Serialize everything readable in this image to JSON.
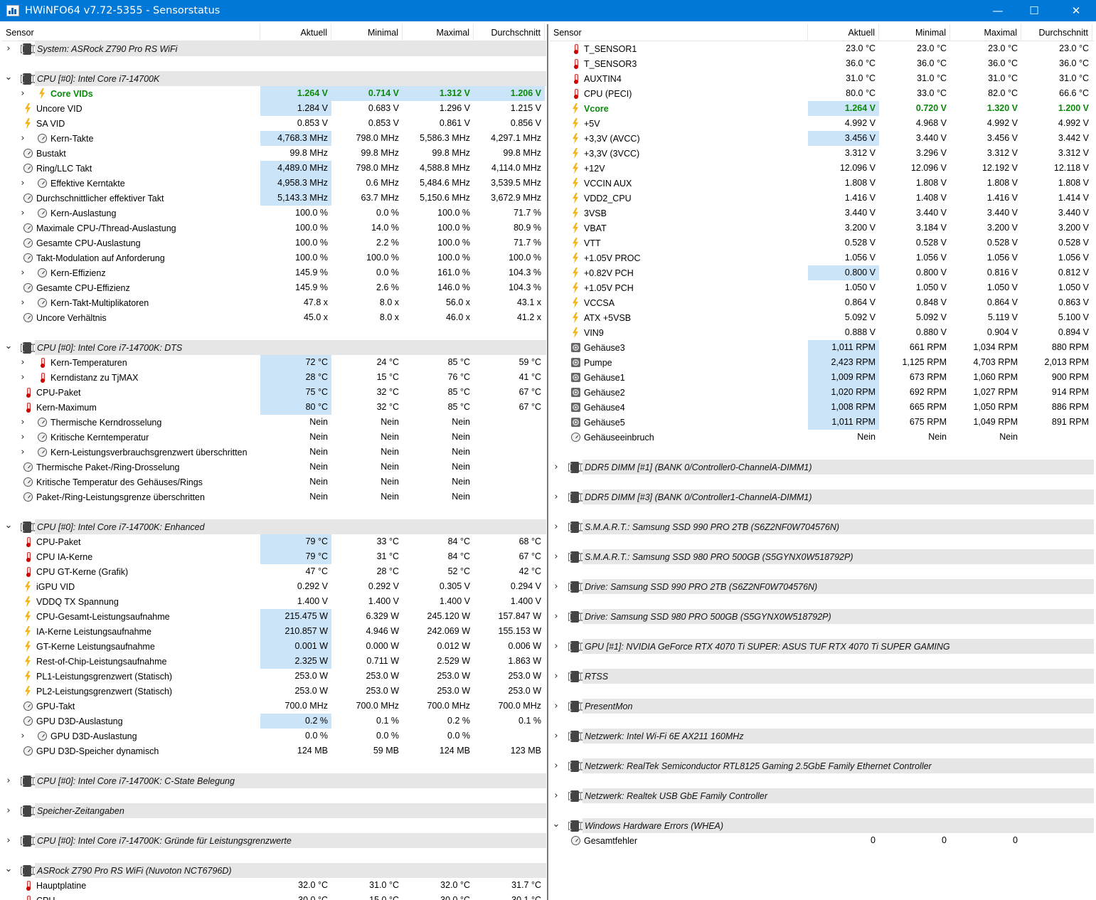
{
  "window": {
    "title": "HWiNFO64 v7.72-5355 - Sensorstatus",
    "minimize_icon": "minimize-icon",
    "maximize_icon": "maximize-icon",
    "close_icon": "close-icon",
    "app_icon": "hwinfo-app-icon"
  },
  "colors": {
    "titlebar": "#0078d7",
    "group_bar": "#e6e6e6",
    "highlight": "#cce4f7",
    "bold_green": "#0a8a0a"
  },
  "columns": [
    "Sensor",
    "Aktuell",
    "Minimal",
    "Maximal",
    "Durchschnitt"
  ],
  "left": [
    {
      "t": "g",
      "e": "c",
      "l": "System: ASRock Z790 Pro RS WiFi"
    },
    {
      "t": "b"
    },
    {
      "t": "g",
      "e": "o",
      "l": "CPU [#0]: Intel Core i7-14700K"
    },
    {
      "i": "bolt",
      "e": "c",
      "in": 1,
      "b": 1,
      "h": [
        1,
        1,
        1,
        1
      ],
      "l": "Core VIDs",
      "v": [
        "1.264 V",
        "0.714 V",
        "1.312 V",
        "1.206 V"
      ]
    },
    {
      "i": "bolt",
      "l": "Uncore VID",
      "h": [
        1,
        0,
        0,
        0
      ],
      "v": [
        "1.284 V",
        "0.683 V",
        "1.296 V",
        "1.215 V"
      ]
    },
    {
      "i": "bolt",
      "l": "SA VID",
      "v": [
        "0.853 V",
        "0.853 V",
        "0.861 V",
        "0.856 V"
      ]
    },
    {
      "i": "clock",
      "e": "c",
      "in": 1,
      "h": [
        1,
        0,
        0,
        0
      ],
      "l": "Kern-Takte",
      "v": [
        "4,768.3 MHz",
        "798.0 MHz",
        "5,586.3 MHz",
        "4,297.1 MHz"
      ]
    },
    {
      "i": "clock",
      "l": "Bustakt",
      "v": [
        "99.8 MHz",
        "99.8 MHz",
        "99.8 MHz",
        "99.8 MHz"
      ]
    },
    {
      "i": "clock",
      "l": "Ring/LLC Takt",
      "h": [
        1,
        0,
        0,
        0
      ],
      "v": [
        "4,489.0 MHz",
        "798.0 MHz",
        "4,588.8 MHz",
        "4,114.0 MHz"
      ]
    },
    {
      "i": "clock",
      "e": "c",
      "in": 1,
      "h": [
        1,
        0,
        0,
        0
      ],
      "l": "Effektive Kerntakte",
      "v": [
        "4,958.3 MHz",
        "0.6 MHz",
        "5,484.6 MHz",
        "3,539.5 MHz"
      ]
    },
    {
      "i": "clock",
      "l": "Durchschnittlicher effektiver Takt",
      "h": [
        1,
        0,
        0,
        0
      ],
      "v": [
        "5,143.3 MHz",
        "63.7 MHz",
        "5,150.6 MHz",
        "3,672.9 MHz"
      ]
    },
    {
      "i": "clock",
      "e": "c",
      "in": 1,
      "l": "Kern-Auslastung",
      "v": [
        "100.0 %",
        "0.0 %",
        "100.0 %",
        "71.7 %"
      ]
    },
    {
      "i": "clock",
      "l": "Maximale CPU-/Thread-Auslastung",
      "v": [
        "100.0 %",
        "14.0 %",
        "100.0 %",
        "80.9 %"
      ]
    },
    {
      "i": "clock",
      "l": "Gesamte CPU-Auslastung",
      "v": [
        "100.0 %",
        "2.2 %",
        "100.0 %",
        "71.7 %"
      ]
    },
    {
      "i": "clock",
      "l": "Takt-Modulation auf Anforderung",
      "v": [
        "100.0 %",
        "100.0 %",
        "100.0 %",
        "100.0 %"
      ]
    },
    {
      "i": "clock",
      "e": "c",
      "in": 1,
      "l": "Kern-Effizienz",
      "v": [
        "145.9 %",
        "0.0 %",
        "161.0 %",
        "104.3 %"
      ]
    },
    {
      "i": "clock",
      "l": "Gesamte CPU-Effizienz",
      "v": [
        "145.9 %",
        "2.6 %",
        "146.0 %",
        "104.3 %"
      ]
    },
    {
      "i": "clock",
      "e": "c",
      "in": 1,
      "l": "Kern-Takt-Multiplikatoren",
      "v": [
        "47.8 x",
        "8.0 x",
        "56.0 x",
        "43.1 x"
      ]
    },
    {
      "i": "clock",
      "l": "Uncore Verhältnis",
      "v": [
        "45.0 x",
        "8.0 x",
        "46.0 x",
        "41.2 x"
      ]
    },
    {
      "t": "b"
    },
    {
      "t": "g",
      "e": "o",
      "l": "CPU [#0]: Intel Core i7-14700K: DTS"
    },
    {
      "i": "therm",
      "e": "c",
      "in": 1,
      "h": [
        1,
        0,
        0,
        0
      ],
      "l": "Kern-Temperaturen",
      "v": [
        "72 °C",
        "24 °C",
        "85 °C",
        "59 °C"
      ]
    },
    {
      "i": "therm",
      "e": "c",
      "in": 1,
      "h": [
        1,
        0,
        0,
        0
      ],
      "l": "Kerndistanz zu TjMAX",
      "v": [
        "28 °C",
        "15 °C",
        "76 °C",
        "41 °C"
      ]
    },
    {
      "i": "therm",
      "l": "CPU-Paket",
      "h": [
        1,
        0,
        0,
        0
      ],
      "v": [
        "75 °C",
        "32 °C",
        "85 °C",
        "67 °C"
      ]
    },
    {
      "i": "therm",
      "l": "Kern-Maximum",
      "h": [
        1,
        0,
        0,
        0
      ],
      "v": [
        "80 °C",
        "32 °C",
        "85 °C",
        "67 °C"
      ]
    },
    {
      "i": "clock",
      "e": "c",
      "in": 1,
      "l": "Thermische Kerndrosselung",
      "v": [
        "Nein",
        "Nein",
        "Nein",
        ""
      ]
    },
    {
      "i": "clock",
      "e": "c",
      "in": 1,
      "l": "Kritische Kerntemperatur",
      "v": [
        "Nein",
        "Nein",
        "Nein",
        ""
      ]
    },
    {
      "i": "clock",
      "e": "c",
      "in": 1,
      "l": "Kern-Leistungsverbrauchsgrenzwert überschritten",
      "v": [
        "Nein",
        "Nein",
        "Nein",
        ""
      ]
    },
    {
      "i": "clock",
      "l": "Thermische Paket-/Ring-Drosselung",
      "v": [
        "Nein",
        "Nein",
        "Nein",
        ""
      ]
    },
    {
      "i": "clock",
      "l": "Kritische Temperatur des Gehäuses/Rings",
      "v": [
        "Nein",
        "Nein",
        "Nein",
        ""
      ]
    },
    {
      "i": "clock",
      "l": "Paket-/Ring-Leistungsgrenze überschritten",
      "v": [
        "Nein",
        "Nein",
        "Nein",
        ""
      ]
    },
    {
      "t": "b"
    },
    {
      "t": "g",
      "e": "o",
      "l": "CPU [#0]: Intel Core i7-14700K: Enhanced"
    },
    {
      "i": "therm",
      "l": "CPU-Paket",
      "h": [
        1,
        0,
        0,
        0
      ],
      "v": [
        "79 °C",
        "33 °C",
        "84 °C",
        "68 °C"
      ]
    },
    {
      "i": "therm",
      "l": "CPU IA-Kerne",
      "h": [
        1,
        0,
        0,
        0
      ],
      "v": [
        "79 °C",
        "31 °C",
        "84 °C",
        "67 °C"
      ]
    },
    {
      "i": "therm",
      "l": "CPU GT-Kerne (Grafik)",
      "v": [
        "47 °C",
        "28 °C",
        "52 °C",
        "42 °C"
      ]
    },
    {
      "i": "bolt",
      "l": "iGPU VID",
      "v": [
        "0.292 V",
        "0.292 V",
        "0.305 V",
        "0.294 V"
      ]
    },
    {
      "i": "bolt",
      "l": "VDDQ TX Spannung",
      "v": [
        "1.400 V",
        "1.400 V",
        "1.400 V",
        "1.400 V"
      ]
    },
    {
      "i": "bolt",
      "l": "CPU-Gesamt-Leistungsaufnahme",
      "h": [
        1,
        0,
        0,
        0
      ],
      "v": [
        "215.475 W",
        "6.329 W",
        "245.120 W",
        "157.847 W"
      ]
    },
    {
      "i": "bolt",
      "l": "IA-Kerne Leistungsaufnahme",
      "h": [
        1,
        0,
        0,
        0
      ],
      "v": [
        "210.857 W",
        "4.946 W",
        "242.069 W",
        "155.153 W"
      ]
    },
    {
      "i": "bolt",
      "l": "GT-Kerne Leistungsaufnahme",
      "h": [
        1,
        0,
        0,
        0
      ],
      "v": [
        "0.001 W",
        "0.000 W",
        "0.012 W",
        "0.006 W"
      ]
    },
    {
      "i": "bolt",
      "l": "Rest-of-Chip-Leistungsaufnahme",
      "h": [
        1,
        0,
        0,
        0
      ],
      "v": [
        "2.325 W",
        "0.711 W",
        "2.529 W",
        "1.863 W"
      ]
    },
    {
      "i": "bolt",
      "l": "PL1-Leistungsgrenzwert (Statisch)",
      "v": [
        "253.0 W",
        "253.0 W",
        "253.0 W",
        "253.0 W"
      ]
    },
    {
      "i": "bolt",
      "l": "PL2-Leistungsgrenzwert (Statisch)",
      "v": [
        "253.0 W",
        "253.0 W",
        "253.0 W",
        "253.0 W"
      ]
    },
    {
      "i": "clock",
      "l": "GPU-Takt",
      "v": [
        "700.0 MHz",
        "700.0 MHz",
        "700.0 MHz",
        "700.0 MHz"
      ]
    },
    {
      "i": "clock",
      "l": "GPU D3D-Auslastung",
      "h": [
        1,
        0,
        0,
        0
      ],
      "v": [
        "0.2 %",
        "0.1 %",
        "0.2 %",
        "0.1 %"
      ]
    },
    {
      "i": "clock",
      "e": "c",
      "in": 1,
      "l": "GPU D3D-Auslastung",
      "v": [
        "0.0 %",
        "0.0 %",
        "0.0 %",
        ""
      ]
    },
    {
      "i": "clock",
      "l": "GPU D3D-Speicher dynamisch",
      "v": [
        "124 MB",
        "59 MB",
        "124 MB",
        "123 MB"
      ]
    },
    {
      "t": "b"
    },
    {
      "t": "g",
      "e": "c",
      "l": "CPU [#0]: Intel Core i7-14700K: C-State Belegung"
    },
    {
      "t": "b"
    },
    {
      "t": "g",
      "e": "c",
      "l": "Speicher-Zeitangaben"
    },
    {
      "t": "b"
    },
    {
      "t": "g",
      "e": "c",
      "l": "CPU [#0]: Intel Core i7-14700K: Gründe für Leistungsgrenzwerte"
    },
    {
      "t": "b"
    },
    {
      "t": "g",
      "e": "o",
      "l": "ASRock Z790 Pro RS WiFi (Nuvoton NCT6796D)"
    },
    {
      "i": "therm",
      "l": "Hauptplatine",
      "v": [
        "32.0 °C",
        "31.0 °C",
        "32.0 °C",
        "31.7 °C"
      ]
    },
    {
      "i": "therm",
      "l": "CPU",
      "v": [
        "30.0 °C",
        "15.0 °C",
        "30.0 °C",
        "30.1 °C"
      ]
    }
  ],
  "right": [
    {
      "i": "therm",
      "l": "T_SENSOR1",
      "v": [
        "23.0 °C",
        "23.0 °C",
        "23.0 °C",
        "23.0 °C"
      ]
    },
    {
      "i": "therm",
      "l": "T_SENSOR3",
      "v": [
        "36.0 °C",
        "36.0 °C",
        "36.0 °C",
        "36.0 °C"
      ]
    },
    {
      "i": "therm",
      "l": "AUXTIN4",
      "v": [
        "31.0 °C",
        "31.0 °C",
        "31.0 °C",
        "31.0 °C"
      ]
    },
    {
      "i": "therm",
      "l": "CPU (PECI)",
      "v": [
        "80.0 °C",
        "33.0 °C",
        "82.0 °C",
        "66.6 °C"
      ]
    },
    {
      "i": "bolt",
      "b": 1,
      "h": [
        1,
        0,
        0,
        0
      ],
      "l": "Vcore",
      "v": [
        "1.264 V",
        "0.720 V",
        "1.320 V",
        "1.200 V"
      ]
    },
    {
      "i": "bolt",
      "l": "+5V",
      "v": [
        "4.992 V",
        "4.968 V",
        "4.992 V",
        "4.992 V"
      ]
    },
    {
      "i": "bolt",
      "l": "+3,3V (AVCC)",
      "h": [
        1,
        0,
        0,
        0
      ],
      "v": [
        "3.456 V",
        "3.440 V",
        "3.456 V",
        "3.442 V"
      ]
    },
    {
      "i": "bolt",
      "l": "+3,3V (3VCC)",
      "v": [
        "3.312 V",
        "3.296 V",
        "3.312 V",
        "3.312 V"
      ]
    },
    {
      "i": "bolt",
      "l": "+12V",
      "v": [
        "12.096 V",
        "12.096 V",
        "12.192 V",
        "12.118 V"
      ]
    },
    {
      "i": "bolt",
      "l": "VCCIN AUX",
      "v": [
        "1.808 V",
        "1.808 V",
        "1.808 V",
        "1.808 V"
      ]
    },
    {
      "i": "bolt",
      "l": "VDD2_CPU",
      "v": [
        "1.416 V",
        "1.408 V",
        "1.416 V",
        "1.414 V"
      ]
    },
    {
      "i": "bolt",
      "l": "3VSB",
      "v": [
        "3.440 V",
        "3.440 V",
        "3.440 V",
        "3.440 V"
      ]
    },
    {
      "i": "bolt",
      "l": "VBAT",
      "v": [
        "3.200 V",
        "3.184 V",
        "3.200 V",
        "3.200 V"
      ]
    },
    {
      "i": "bolt",
      "l": "VTT",
      "v": [
        "0.528 V",
        "0.528 V",
        "0.528 V",
        "0.528 V"
      ]
    },
    {
      "i": "bolt",
      "l": "+1.05V PROC",
      "v": [
        "1.056 V",
        "1.056 V",
        "1.056 V",
        "1.056 V"
      ]
    },
    {
      "i": "bolt",
      "l": "+0.82V PCH",
      "h": [
        1,
        0,
        0,
        0
      ],
      "v": [
        "0.800 V",
        "0.800 V",
        "0.816 V",
        "0.812 V"
      ]
    },
    {
      "i": "bolt",
      "l": "+1.05V PCH",
      "v": [
        "1.050 V",
        "1.050 V",
        "1.050 V",
        "1.050 V"
      ]
    },
    {
      "i": "bolt",
      "l": "VCCSA",
      "v": [
        "0.864 V",
        "0.848 V",
        "0.864 V",
        "0.863 V"
      ]
    },
    {
      "i": "bolt",
      "l": "ATX +5VSB",
      "v": [
        "5.092 V",
        "5.092 V",
        "5.119 V",
        "5.100 V"
      ]
    },
    {
      "i": "bolt",
      "l": "VIN9",
      "v": [
        "0.888 V",
        "0.880 V",
        "0.904 V",
        "0.894 V"
      ]
    },
    {
      "i": "fan",
      "l": "Gehäuse3",
      "h": [
        1,
        0,
        0,
        0
      ],
      "v": [
        "1,011 RPM",
        "661 RPM",
        "1,034 RPM",
        "880 RPM"
      ]
    },
    {
      "i": "fan",
      "l": "Pumpe",
      "h": [
        1,
        0,
        0,
        0
      ],
      "v": [
        "2,423 RPM",
        "1,125 RPM",
        "4,703 RPM",
        "2,013 RPM"
      ]
    },
    {
      "i": "fan",
      "l": "Gehäuse1",
      "h": [
        1,
        0,
        0,
        0
      ],
      "v": [
        "1,009 RPM",
        "673 RPM",
        "1,060 RPM",
        "900 RPM"
      ]
    },
    {
      "i": "fan",
      "l": "Gehäuse2",
      "h": [
        1,
        0,
        0,
        0
      ],
      "v": [
        "1,020 RPM",
        "692 RPM",
        "1,027 RPM",
        "914 RPM"
      ]
    },
    {
      "i": "fan",
      "l": "Gehäuse4",
      "h": [
        1,
        0,
        0,
        0
      ],
      "v": [
        "1,008 RPM",
        "665 RPM",
        "1,050 RPM",
        "886 RPM"
      ]
    },
    {
      "i": "fan",
      "l": "Gehäuse5",
      "h": [
        1,
        0,
        0,
        0
      ],
      "v": [
        "1,011 RPM",
        "675 RPM",
        "1,049 RPM",
        "891 RPM"
      ]
    },
    {
      "i": "clock",
      "l": "Gehäuseeinbruch",
      "v": [
        "Nein",
        "Nein",
        "Nein",
        ""
      ]
    },
    {
      "t": "b"
    },
    {
      "t": "g",
      "e": "c",
      "l": "DDR5 DIMM [#1] (BANK 0/Controller0-ChannelA-DIMM1)"
    },
    {
      "t": "b"
    },
    {
      "t": "g",
      "e": "c",
      "l": "DDR5 DIMM [#3] (BANK 0/Controller1-ChannelA-DIMM1)"
    },
    {
      "t": "b"
    },
    {
      "t": "g",
      "e": "c",
      "l": "S.M.A.R.T.: Samsung SSD 990 PRO 2TB (S6Z2NF0W704576N)"
    },
    {
      "t": "b"
    },
    {
      "t": "g",
      "e": "c",
      "l": "S.M.A.R.T.: Samsung SSD 980 PRO 500GB (S5GYNX0W518792P)"
    },
    {
      "t": "b"
    },
    {
      "t": "g",
      "e": "c",
      "l": "Drive: Samsung SSD 990 PRO 2TB (S6Z2NF0W704576N)"
    },
    {
      "t": "b"
    },
    {
      "t": "g",
      "e": "c",
      "l": "Drive: Samsung SSD 980 PRO 500GB (S5GYNX0W518792P)"
    },
    {
      "t": "b"
    },
    {
      "t": "g",
      "e": "c",
      "l": "GPU [#1]: NVIDIA GeForce RTX 4070 Ti SUPER: ASUS TUF RTX 4070 Ti SUPER GAMING"
    },
    {
      "t": "b"
    },
    {
      "t": "g",
      "e": "c",
      "l": "RTSS"
    },
    {
      "t": "b"
    },
    {
      "t": "g",
      "e": "c",
      "l": "PresentMon"
    },
    {
      "t": "b"
    },
    {
      "t": "g",
      "e": "c",
      "l": "Netzwerk: Intel Wi-Fi 6E AX211 160MHz"
    },
    {
      "t": "b"
    },
    {
      "t": "g",
      "e": "c",
      "l": "Netzwerk: RealTek Semiconductor RTL8125 Gaming 2.5GbE Family Ethernet Controller"
    },
    {
      "t": "b"
    },
    {
      "t": "g",
      "e": "c",
      "l": "Netzwerk: Realtek USB GbE Family Controller"
    },
    {
      "t": "b"
    },
    {
      "t": "g",
      "e": "o",
      "l": "Windows Hardware Errors (WHEA)"
    },
    {
      "i": "clock",
      "l": "Gesamtfehler",
      "v": [
        "0",
        "0",
        "0",
        ""
      ]
    }
  ]
}
